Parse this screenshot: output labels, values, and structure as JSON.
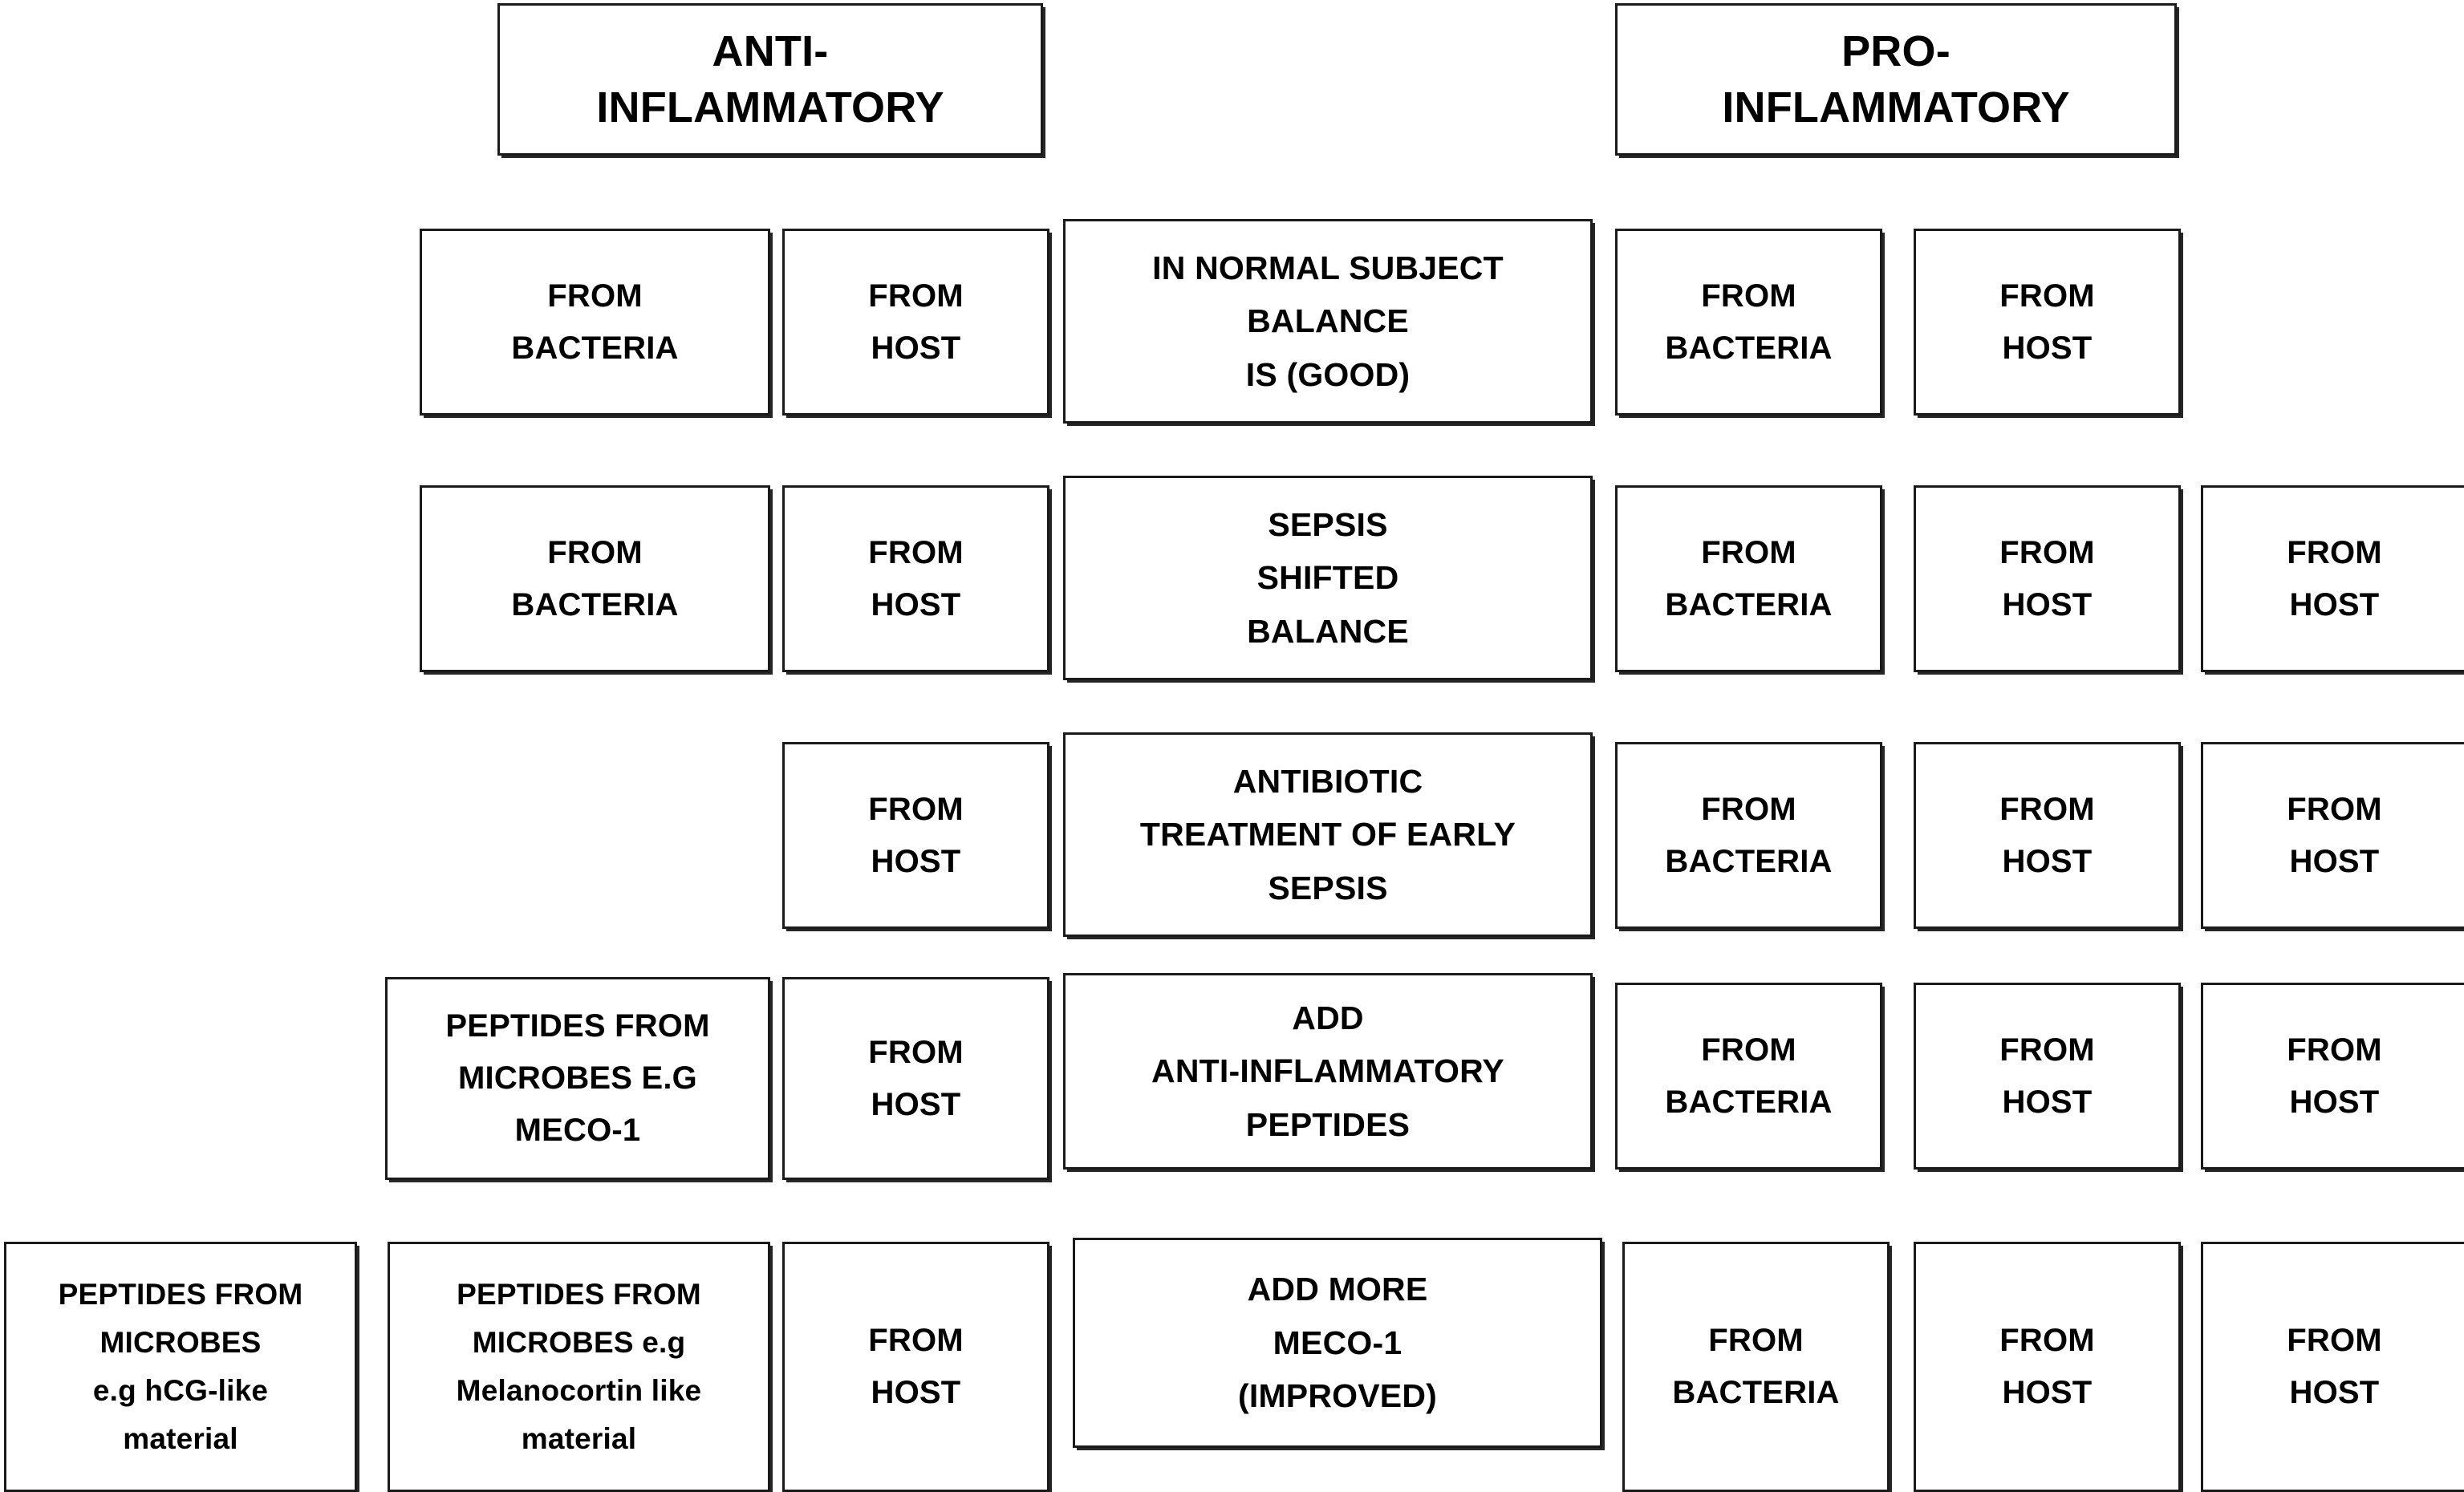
{
  "diagram": {
    "title_row": {
      "left_header": {
        "lines": [
          "ANTI-",
          "INFLAMMATORY"
        ]
      },
      "right_header": {
        "lines": [
          "PRO-",
          "INFLAMMATORY"
        ]
      }
    },
    "rows": [
      {
        "id": "normal-subject",
        "boxes": [
          {
            "id": "r1-anti-bacteria",
            "kind": "cell",
            "lines": [
              "FROM",
              "BACTERIA"
            ]
          },
          {
            "id": "r1-anti-host",
            "kind": "cell",
            "lines": [
              "FROM",
              "HOST"
            ]
          },
          {
            "id": "r1-center",
            "kind": "stmt",
            "lines": [
              "IN NORMAL SUBJECT",
              "BALANCE",
              "IS (GOOD)"
            ]
          },
          {
            "id": "r1-pro-bacteria",
            "kind": "cell",
            "lines": [
              "FROM",
              "BACTERIA"
            ]
          },
          {
            "id": "r1-pro-host",
            "kind": "cell",
            "lines": [
              "FROM",
              "HOST"
            ]
          }
        ]
      },
      {
        "id": "sepsis",
        "boxes": [
          {
            "id": "r2-anti-bacteria",
            "kind": "cell",
            "lines": [
              "FROM",
              "BACTERIA"
            ]
          },
          {
            "id": "r2-anti-host",
            "kind": "cell",
            "lines": [
              "FROM",
              "HOST"
            ]
          },
          {
            "id": "r2-center",
            "kind": "stmt",
            "lines": [
              "SEPSIS",
              "SHIFTED",
              "BALANCE"
            ]
          },
          {
            "id": "r2-pro-bacteria",
            "kind": "cell",
            "lines": [
              "FROM",
              "BACTERIA"
            ]
          },
          {
            "id": "r2-pro-host-1",
            "kind": "cell",
            "lines": [
              "FROM",
              "HOST"
            ]
          },
          {
            "id": "r2-pro-host-2",
            "kind": "cell",
            "lines": [
              "FROM",
              "HOST"
            ]
          }
        ]
      },
      {
        "id": "antibiotic-treatment",
        "boxes": [
          {
            "id": "r3-anti-host",
            "kind": "cell",
            "lines": [
              "FROM",
              "HOST"
            ]
          },
          {
            "id": "r3-center",
            "kind": "stmt",
            "lines": [
              "ANTIBIOTIC",
              "TREATMENT OF EARLY",
              "SEPSIS"
            ]
          },
          {
            "id": "r3-pro-bacteria",
            "kind": "cell",
            "lines": [
              "FROM",
              "BACTERIA"
            ]
          },
          {
            "id": "r3-pro-host-1",
            "kind": "cell",
            "lines": [
              "FROM",
              "HOST"
            ]
          },
          {
            "id": "r3-pro-host-2",
            "kind": "cell",
            "lines": [
              "FROM",
              "HOST"
            ]
          }
        ]
      },
      {
        "id": "add-anti-inflammatory-peptides",
        "boxes": [
          {
            "id": "r4-anti-peptides",
            "kind": "cell",
            "lines": [
              "PEPTIDES FROM",
              "MICROBES E.G",
              "MECO-1"
            ]
          },
          {
            "id": "r4-anti-host",
            "kind": "cell",
            "lines": [
              "FROM",
              "HOST"
            ]
          },
          {
            "id": "r4-center",
            "kind": "stmt",
            "lines": [
              "ADD",
              "ANTI-INFLAMMATORY",
              "PEPTIDES"
            ]
          },
          {
            "id": "r4-pro-bacteria",
            "kind": "cell",
            "lines": [
              "FROM",
              "BACTERIA"
            ]
          },
          {
            "id": "r4-pro-host-1",
            "kind": "cell",
            "lines": [
              "FROM",
              "HOST"
            ]
          },
          {
            "id": "r4-pro-host-2",
            "kind": "cell",
            "lines": [
              "FROM",
              "HOST"
            ]
          }
        ]
      },
      {
        "id": "add-more-meco-1",
        "boxes": [
          {
            "id": "r5-anti-hcg",
            "kind": "small",
            "lines": [
              "PEPTIDES FROM",
              "MICROBES",
              "e.g hCG-like",
              "material"
            ]
          },
          {
            "id": "r5-anti-melanocortin",
            "kind": "small",
            "lines": [
              "PEPTIDES FROM",
              "MICROBES e.g",
              "Melanocortin like",
              "material"
            ]
          },
          {
            "id": "r5-anti-host",
            "kind": "cell",
            "lines": [
              "FROM",
              "HOST"
            ]
          },
          {
            "id": "r5-center",
            "kind": "stmt",
            "lines": [
              "ADD MORE",
              "MECO-1",
              "(IMPROVED)"
            ]
          },
          {
            "id": "r5-pro-bacteria",
            "kind": "cell",
            "lines": [
              "FROM",
              "BACTERIA"
            ]
          },
          {
            "id": "r5-pro-host-1",
            "kind": "cell",
            "lines": [
              "FROM",
              "HOST"
            ]
          },
          {
            "id": "r5-pro-host-2",
            "kind": "cell",
            "lines": [
              "FROM",
              "HOST"
            ]
          }
        ]
      }
    ],
    "colors": {
      "border": "#1a1a1a",
      "text": "#000000",
      "background": "#ffffff"
    }
  }
}
